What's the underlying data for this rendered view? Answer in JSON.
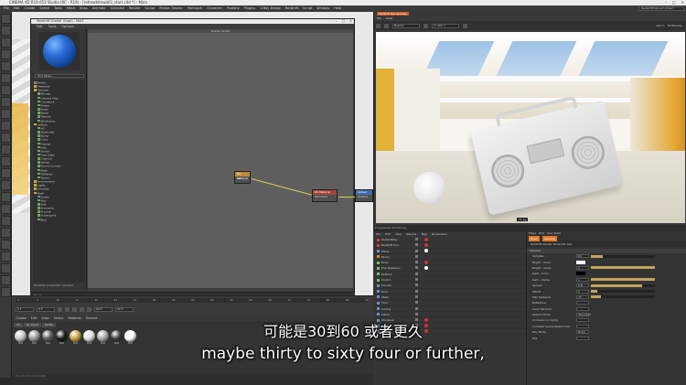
{
  "window": {
    "title": "CINEMA 4D R19.053 Studio (RC - R19) - [retrowhitewall3_start.c4d *] - Main",
    "layout_label": "Layout:",
    "layout_value": "RedshiftPlatinum (User)"
  },
  "menubar": [
    "File",
    "Edit",
    "Create",
    "Select",
    "Tools",
    "Mesh",
    "Snap",
    "Animate",
    "Simulate",
    "Render",
    "Sculpt",
    "Motion Tracker",
    "MoGraph",
    "Character",
    "Pipeline",
    "Plugins",
    "V-Ray Bridge",
    "Redshift",
    "Script",
    "Window",
    "Help"
  ],
  "node_editor": {
    "title": "Redshift Shader Graph - Mat1",
    "menu": [
      "Edit",
      "Tools",
      "Options"
    ],
    "graph_title": "Shader Graph",
    "search_placeholder": "Find Node...",
    "tree": [
      {
        "label": "Nodes",
        "kind": "w"
      },
      {
        "label": "Materials",
        "kind": "y"
      },
      {
        "label": "Textures",
        "kind": "y"
      },
      {
        "label": "Bitmap",
        "kind": "g"
      },
      {
        "label": "Camera Map",
        "kind": "g"
      },
      {
        "label": "Curvature",
        "kind": "g"
      },
      {
        "label": "Flakes",
        "kind": "g"
      },
      {
        "label": "Noise",
        "kind": "g"
      },
      {
        "label": "Ramp",
        "kind": "g"
      },
      {
        "label": "Texture",
        "kind": "g"
      },
      {
        "label": "Wireframe",
        "kind": "g"
      },
      {
        "label": "Utilities",
        "kind": "y"
      },
      {
        "label": "AO",
        "kind": "g"
      },
      {
        "label": "Attributes",
        "kind": "g"
      },
      {
        "label": "Bump",
        "kind": "g"
      },
      {
        "label": "Color",
        "kind": "g"
      },
      {
        "label": "Fresnel",
        "kind": "g"
      },
      {
        "label": "Hair",
        "kind": "g"
      },
      {
        "label": "Switch",
        "kind": "g"
      },
      {
        "label": "User Data",
        "kind": "g"
      },
      {
        "label": "Channel",
        "kind": "g"
      },
      {
        "label": "Vertex",
        "kind": "g"
      },
      {
        "label": "Round Corners",
        "kind": "g"
      },
      {
        "label": "Math",
        "kind": "g"
      },
      {
        "label": "TriPlanar",
        "kind": "g"
      },
      {
        "label": "Vector",
        "kind": "g"
      },
      {
        "label": "Environment",
        "kind": "y"
      },
      {
        "label": "Lights",
        "kind": "y"
      },
      {
        "label": "Volumes",
        "kind": "y"
      },
      {
        "label": "Math",
        "kind": "y"
      },
      {
        "label": "Scalar",
        "kind": "b"
      },
      {
        "label": "Abs",
        "kind": "g"
      },
      {
        "label": "Add",
        "kind": "g"
      },
      {
        "label": "Arccosine",
        "kind": "g"
      },
      {
        "label": "Arcsine",
        "kind": "g"
      },
      {
        "label": "Arctangent",
        "kind": "g"
      },
      {
        "label": "Bias",
        "kind": "g"
      }
    ],
    "tree_footer": "Redshift accelerator sampler",
    "status": "Ready",
    "nodes": {
      "n1": {
        "title": "RS Material",
        "port": "Out"
      },
      "n2": {
        "title": "RS Material",
        "port": "Out Color"
      },
      "n3": {
        "title": "Output",
        "port": "Surface"
      }
    }
  },
  "timeline": {
    "ticks": [
      "0",
      "5",
      "10",
      "15",
      "20",
      "25",
      "30",
      "35",
      "40",
      "45",
      "50",
      "55",
      "60",
      "65",
      "70",
      "75",
      "80",
      "85",
      "90"
    ],
    "start": "0 F",
    "current": "0 F",
    "end": "90 F",
    "end2": "90 F"
  },
  "material_manager": {
    "menu": [
      "Create",
      "Edit",
      "View",
      "Select",
      "Material",
      "Texture"
    ],
    "tabs": [
      "All",
      "No Layer",
      "Redsh"
    ],
    "materials": [
      {
        "label": "Mat",
        "color": "#c9c9c9"
      },
      {
        "label": "Mat",
        "color": "#9a9a9a"
      },
      {
        "label": "Mat",
        "color": "#5c5c5c"
      },
      {
        "label": "Mat",
        "color": "#1b1b1b"
      },
      {
        "label": "Mat",
        "color": "#c9a348"
      },
      {
        "label": "Mat",
        "color": "#e1e1e1"
      },
      {
        "label": "Mat",
        "color": "#a8a8a8"
      },
      {
        "label": "Mat",
        "color": "#3b3b3b"
      },
      {
        "label": "Mat",
        "color": "#ffffff"
      }
    ],
    "coords": "X  0 cm    Y  0 cm    Z  0 cm"
  },
  "render_view": {
    "title": "Redshift RenderView",
    "menu": [
      "File",
      "View"
    ],
    "beauty_label": "Beauty",
    "aov_label": "1: AOV 1",
    "zoom": "100 %",
    "fit_label": "Fit Window",
    "image_tag": "11 Lg",
    "progress": "Progressive Rendering..."
  },
  "object_manager": {
    "menu": [
      "File",
      "Edit",
      "View",
      "Objects",
      "Tags",
      "Bookmarks"
    ],
    "rows": [
      {
        "label": "RedshiftSky",
        "dot": "r",
        "tag": "r"
      },
      {
        "label": "Redshift Sun",
        "dot": "r",
        "tag": "r"
      },
      {
        "label": "Plane",
        "dot": "b",
        "tag": "w"
      },
      {
        "label": "Boom",
        "dot": "o",
        "tag": "none"
      },
      {
        "label": "Body",
        "dot": "g",
        "tag": "r"
      },
      {
        "label": "Dial Speakers",
        "dot": "g",
        "tag": "w"
      },
      {
        "label": "Buttons",
        "dot": "g",
        "tag": "none"
      },
      {
        "label": "Knob 1",
        "dot": "g",
        "tag": "none"
      },
      {
        "label": "Handle",
        "dot": "b",
        "tag": "none"
      },
      {
        "label": "Roof",
        "dot": "b",
        "tag": "none"
      },
      {
        "label": "Walls",
        "dot": "b",
        "tag": "none"
      },
      {
        "label": "Floor",
        "dot": "b",
        "tag": "none"
      },
      {
        "label": "Ceiling",
        "dot": "b",
        "tag": "none"
      },
      {
        "label": "Pillars",
        "dot": "b",
        "tag": "none"
      },
      {
        "label": "Windows",
        "dot": "b",
        "tag": "r"
      },
      {
        "label": "Lights",
        "dot": "b",
        "tag": "r"
      },
      {
        "label": "Camera",
        "dot": "b",
        "tag": "r"
      }
    ]
  },
  "attribute_manager": {
    "tabs": [
      "Mode",
      "Edit",
      "User Data"
    ],
    "active_tab": "Basic",
    "tab2": "General",
    "header": "Redshift Shader Node [RS AO]",
    "section": "General",
    "rows": [
      {
        "label": "Samples",
        "value": "64",
        "fill": 0.18,
        "swatch": ""
      },
      {
        "label": "Bright - Color",
        "value": "",
        "fill": 0,
        "swatch": "#ffffff"
      },
      {
        "label": "Bright - Alpha",
        "value": "1",
        "fill": 1.0,
        "swatch": ""
      },
      {
        "label": "Dark - Color",
        "value": "",
        "fill": 0,
        "swatch": "#000000"
      },
      {
        "label": "Dark - Alpha",
        "value": "1",
        "fill": 1.0,
        "swatch": ""
      },
      {
        "label": "Spread",
        "value": "0.8",
        "fill": 0.8,
        "swatch": ""
      },
      {
        "label": "Falloff",
        "value": "1",
        "fill": 0.1,
        "swatch": ""
      },
      {
        "label": "Max Distance",
        "value": "15",
        "fill": 0.15,
        "swatch": ""
      },
      {
        "label": "Reflective",
        "value": "",
        "fill": 0,
        "swatch": ""
      },
      {
        "label": "Invert Normal",
        "value": "",
        "fill": 0,
        "swatch": ""
      },
      {
        "label": "Output Mode",
        "value": "Standard",
        "fill": 0,
        "swatch": ""
      },
      {
        "label": "Occlusion in Alpha",
        "value": "",
        "fill": 0,
        "swatch": ""
      },
      {
        "label": "Consider Same Object Only",
        "value": "",
        "fill": 0,
        "swatch": ""
      },
      {
        "label": "Ray Mode",
        "value": "None",
        "fill": 0,
        "swatch": ""
      },
      {
        "label": "Eps",
        "value": "",
        "fill": 0,
        "swatch": ""
      }
    ]
  },
  "subtitles": {
    "zh": "可能是30到60 或者更久",
    "en": "maybe thirty to sixty four or further,"
  }
}
